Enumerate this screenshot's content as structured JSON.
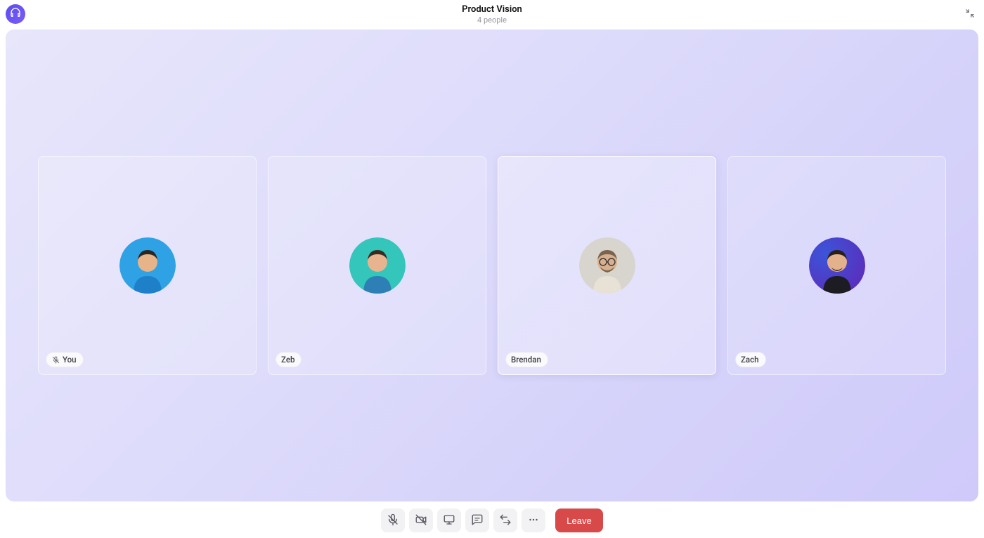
{
  "header": {
    "title": "Product Vision",
    "subtitle": "4 people"
  },
  "participants": [
    {
      "name": "You",
      "mic_muted": true,
      "speaking": false,
      "avatar_bg": "#2fa2e6",
      "shirt": "#1e80c9",
      "skin": "#e7b48a",
      "hair": "#2d2620"
    },
    {
      "name": "Zeb",
      "mic_muted": false,
      "speaking": false,
      "avatar_bg": "#35c6bb",
      "shirt": "#2d7fb5",
      "skin": "#e8b48f",
      "hair": "#3a2b20"
    },
    {
      "name": "Brendan",
      "mic_muted": false,
      "speaking": true,
      "avatar_bg": "#d8d5ce",
      "shirt": "#e7e1d6",
      "skin": "#d9b08f",
      "hair": "#7a644e"
    },
    {
      "name": "Zach",
      "mic_muted": false,
      "speaking": false,
      "avatar_bg": "#5a2ebc",
      "shirt": "#1c1c22",
      "skin": "#e3b18c",
      "hair": "#2a1f18"
    }
  ],
  "dock": {
    "leave_label": "Leave",
    "buttons": [
      {
        "id": "mic",
        "active_off": true
      },
      {
        "id": "camera",
        "active_off": true
      },
      {
        "id": "share",
        "active_off": false
      },
      {
        "id": "chat",
        "active_off": false
      },
      {
        "id": "swap",
        "active_off": false
      },
      {
        "id": "more",
        "active_off": false
      }
    ]
  }
}
